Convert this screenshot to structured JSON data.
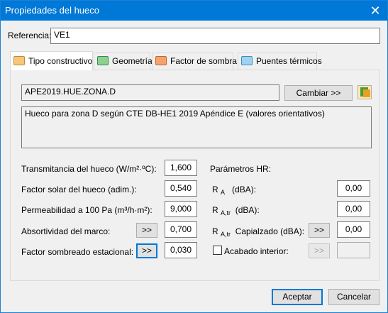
{
  "window": {
    "title": "Propiedades del hueco",
    "close_glyph": "✕"
  },
  "referencia": {
    "label": "Referencia:",
    "value": "VE1"
  },
  "tabs": [
    {
      "label": "Tipo constructivo",
      "icon": "window-icon"
    },
    {
      "label": "Geometría",
      "icon": "geometry-icon"
    },
    {
      "label": "Factor de sombra",
      "icon": "shade-icon"
    },
    {
      "label": "Puentes térmicos",
      "icon": "thermal-bridge-icon"
    }
  ],
  "construction": {
    "code": "APE2019.HUE.ZONA.D",
    "change_button": "Cambiar >>",
    "description": "Hueco para zona D según CTE DB-HE1 2019 Apéndice E (valores orientativos)"
  },
  "left_params": {
    "transmitancia_label": "Transmitancia del hueco (W/m²·ºC):",
    "transmitancia_value": "1,600",
    "factor_solar_label": "Factor solar del hueco (adim.):",
    "factor_solar_value": "0,540",
    "permeabilidad_label": "Permeabilidad a 100 Pa (m³/h·m²):",
    "permeabilidad_value": "9,000",
    "absortividad_label": "Absortividad del marco:",
    "absortividad_value": "0,700",
    "sombreado_label": "Factor sombreado estacional:",
    "sombreado_value": "0,030",
    "more_button": ">>"
  },
  "right_params": {
    "heading": "Parámetros HR:",
    "ra_label": "R",
    "ra_sub": "A",
    "ra_unit": "(dBA):",
    "ra_value": "0,00",
    "ratr_label": "R",
    "ratr_sub": "A,tr",
    "ratr_unit": "(dBA):",
    "ratr_value": "0,00",
    "ratr_cap_label": "R",
    "ratr_cap_sub": "A,tr",
    "ratr_cap_unit": "Capialzado (dBA):",
    "ratr_cap_value": "0,00",
    "acabado_label": "Acabado interior:",
    "acabado_checked": false,
    "acabado_value": ""
  },
  "footer": {
    "accept": "Aceptar",
    "cancel": "Cancelar"
  },
  "colors": {
    "titlebar": "#0078d7",
    "accent": "#0078d7"
  }
}
